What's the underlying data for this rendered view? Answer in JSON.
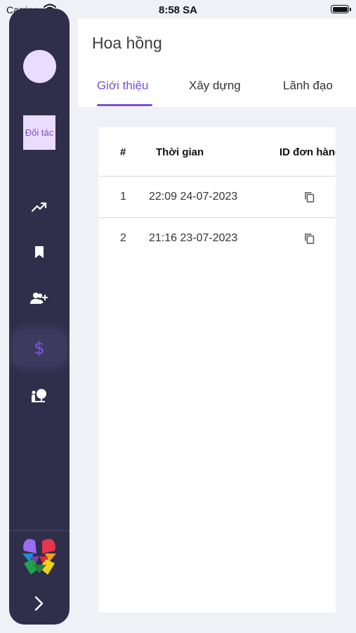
{
  "status_bar": {
    "carrier": "Carrier",
    "time": "8:58 SA"
  },
  "sidebar": {
    "partner_label": "Đối tác",
    "nav_items": [
      {
        "icon": "trending-up-icon"
      },
      {
        "icon": "bookmark-icon"
      },
      {
        "icon": "add-user-icon"
      },
      {
        "icon": "dollar-icon",
        "active": true
      },
      {
        "icon": "mentor-board-icon"
      }
    ],
    "active_icon_glyph": "$",
    "accent_color": "#7f57e0",
    "background_color": "#2f2f4b"
  },
  "header": {
    "title": "Hoa hồng",
    "tabs": [
      {
        "label": "Giới thiệu",
        "active": true
      },
      {
        "label": "Xây dựng"
      },
      {
        "label": "Lãnh đạo"
      }
    ]
  },
  "table": {
    "columns": [
      "#",
      "Thời gian",
      "ID đơn hàng"
    ],
    "rows": [
      {
        "index": "1",
        "time": "22:09 24-07-2023",
        "action_icon": "copy-icon"
      },
      {
        "index": "2",
        "time": "21:16 23-07-2023",
        "action_icon": "copy-icon"
      }
    ]
  }
}
